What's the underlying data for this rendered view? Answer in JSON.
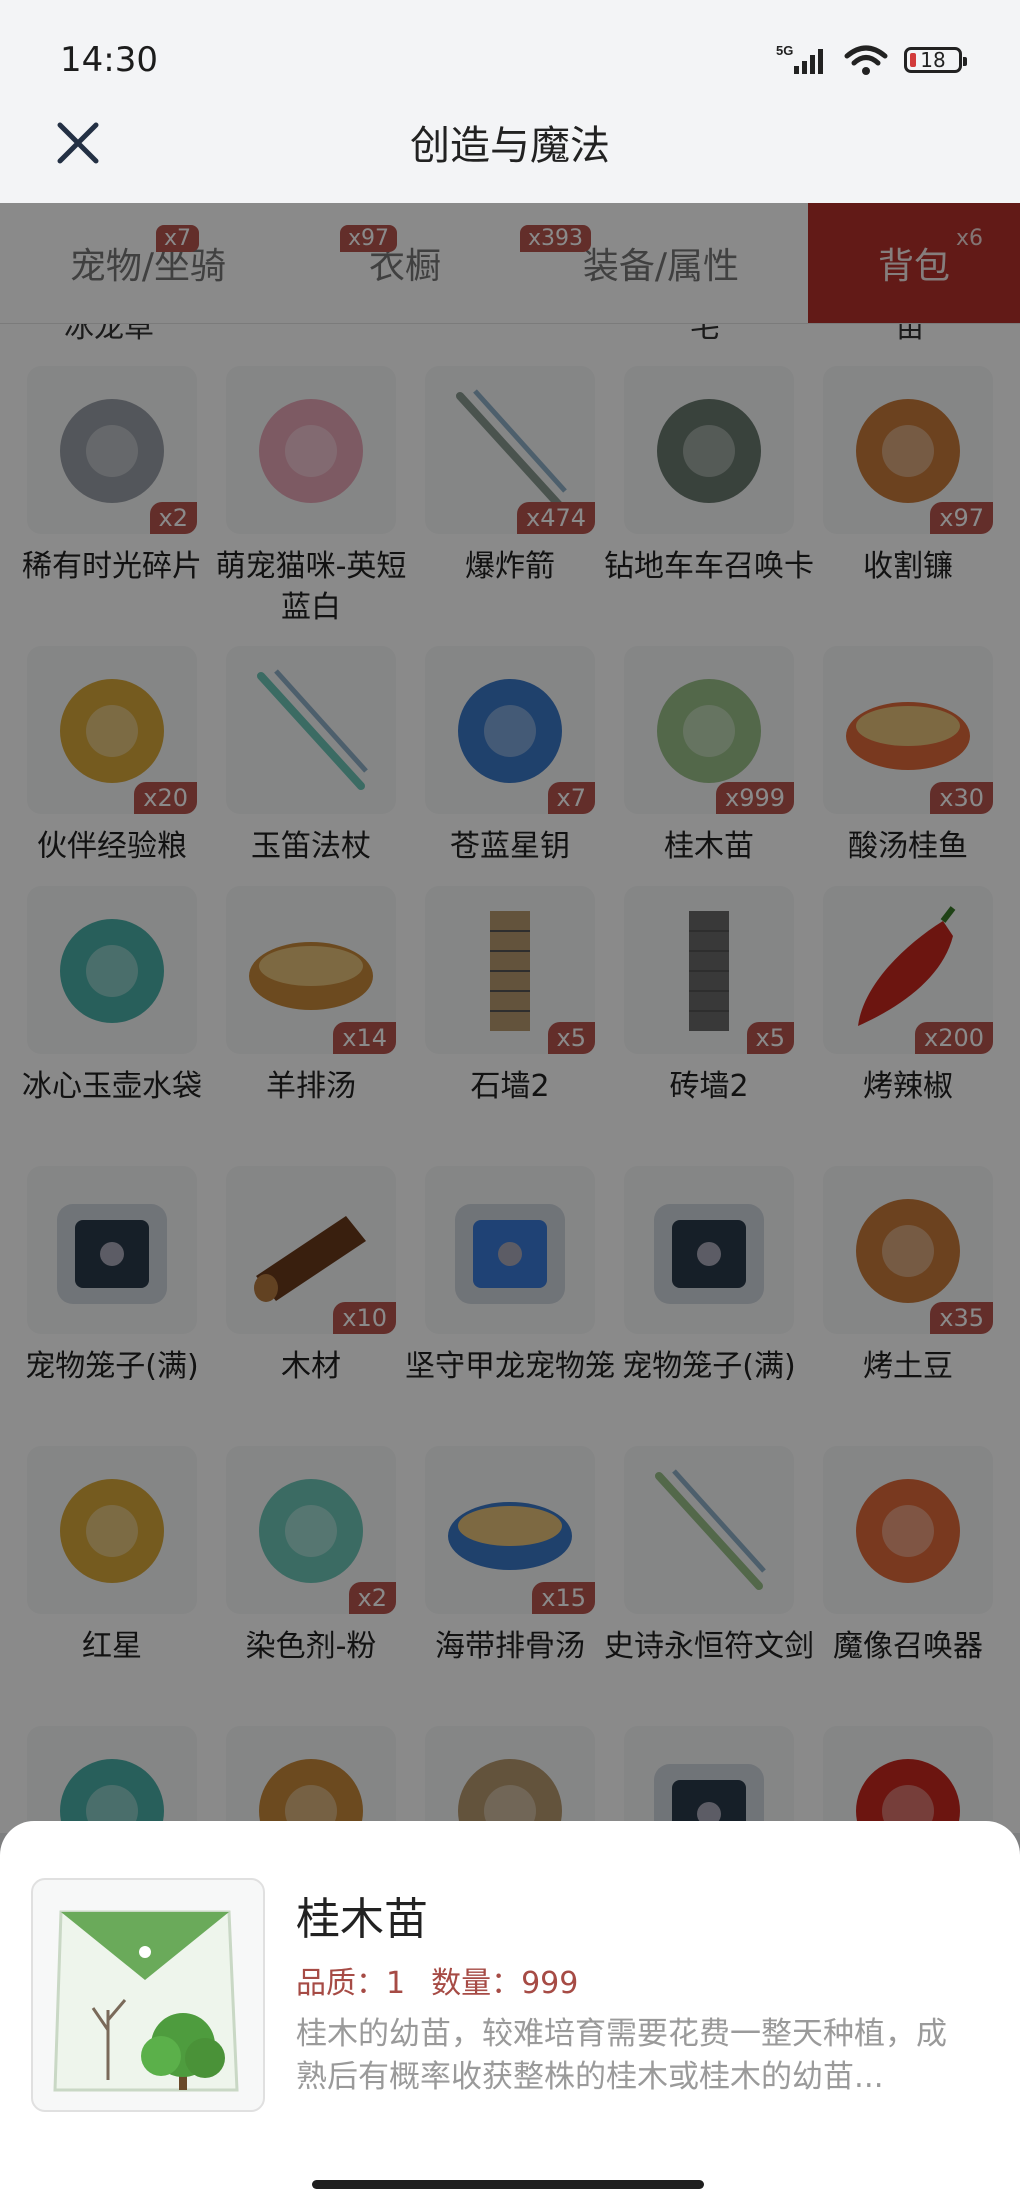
{
  "status_bar": {
    "time": "14:30",
    "network": "5G",
    "battery": "18"
  },
  "header": {
    "title": "创造与魔法"
  },
  "tabs": [
    {
      "label": "宠物/坐骑",
      "badge": "x7",
      "active": false
    },
    {
      "label": "衣橱",
      "badge": "x97",
      "active": false
    },
    {
      "label": "装备/属性",
      "badge": "x393",
      "active": false
    },
    {
      "label": "背包",
      "badge": "x6",
      "active": true
    }
  ],
  "partial_top_labels": [
    "冰龙草",
    "宅",
    "苗"
  ],
  "items": [
    {
      "name": "稀有时光碎片",
      "qty": "x2",
      "icon": "time-fragment-icon"
    },
    {
      "name": "萌宠猫咪-英短蓝白",
      "qty": "",
      "icon": "cat-tree-icon"
    },
    {
      "name": "爆炸箭",
      "qty": "x474",
      "icon": "arrows-icon"
    },
    {
      "name": "钻地车车召唤卡",
      "qty": "",
      "icon": "summon-card-icon"
    },
    {
      "name": "收割镰",
      "qty": "x97",
      "icon": "sickle-icon"
    },
    {
      "name": "伙伴经验粮",
      "qty": "x20",
      "icon": "food-bag-icon"
    },
    {
      "name": "玉笛法杖",
      "qty": "",
      "icon": "flute-staff-icon"
    },
    {
      "name": "苍蓝星钥",
      "qty": "x7",
      "icon": "star-key-icon"
    },
    {
      "name": "桂木苗",
      "qty": "x999",
      "icon": "seed-packet-icon"
    },
    {
      "name": "酸汤桂鱼",
      "qty": "x30",
      "icon": "fish-dish-icon"
    },
    {
      "name": "冰心玉壶水袋",
      "qty": "",
      "icon": "jade-pot-icon"
    },
    {
      "name": "羊排汤",
      "qty": "x14",
      "icon": "soup-bowl-icon"
    },
    {
      "name": "石墙2",
      "qty": "x5",
      "icon": "stone-wall-icon"
    },
    {
      "name": "砖墙2",
      "qty": "x5",
      "icon": "brick-wall-icon"
    },
    {
      "name": "烤辣椒",
      "qty": "x200",
      "icon": "chili-icon"
    },
    {
      "name": "宠物笼子(满)",
      "qty": "",
      "icon": "pet-cage-icon"
    },
    {
      "name": "木材",
      "qty": "x10",
      "icon": "wood-log-icon"
    },
    {
      "name": "坚守甲龙宠物笼",
      "qty": "",
      "icon": "pet-cage-blue-icon"
    },
    {
      "name": "宠物笼子(满)",
      "qty": "",
      "icon": "pet-cage-icon"
    },
    {
      "name": "烤土豆",
      "qty": "x35",
      "icon": "potato-icon"
    },
    {
      "name": "红星",
      "qty": "",
      "icon": "motorcycle-icon"
    },
    {
      "name": "染色剂-粉",
      "qty": "x2",
      "icon": "pink-dress-icon"
    },
    {
      "name": "海带排骨汤",
      "qty": "x15",
      "icon": "soup-bowl-icon"
    },
    {
      "name": "史诗永恒符文剑",
      "qty": "",
      "icon": "rune-sword-icon"
    },
    {
      "name": "魔像召唤器",
      "qty": "",
      "icon": "golem-summoner-icon"
    },
    {
      "name": "",
      "qty": "",
      "icon": "wood-bundle-icon"
    },
    {
      "name": "",
      "qty": "",
      "icon": "horn-icon"
    },
    {
      "name": "",
      "qty": "",
      "icon": "apple-icon"
    },
    {
      "name": "",
      "qty": "",
      "icon": "cage-icon"
    },
    {
      "name": "",
      "qty": "",
      "icon": "potion-icon"
    }
  ],
  "detail": {
    "name": "桂木苗",
    "quality_label": "品质：1",
    "quantity_label": "数量：999",
    "description": "桂木的幼苗，较难培育需要花费一整天种植，成熟后有概率收获整株的桂木或桂木的幼苗..."
  },
  "colors": {
    "accent": "#b5302b",
    "badge": "#b8554f",
    "meta_text": "#a64b45"
  }
}
